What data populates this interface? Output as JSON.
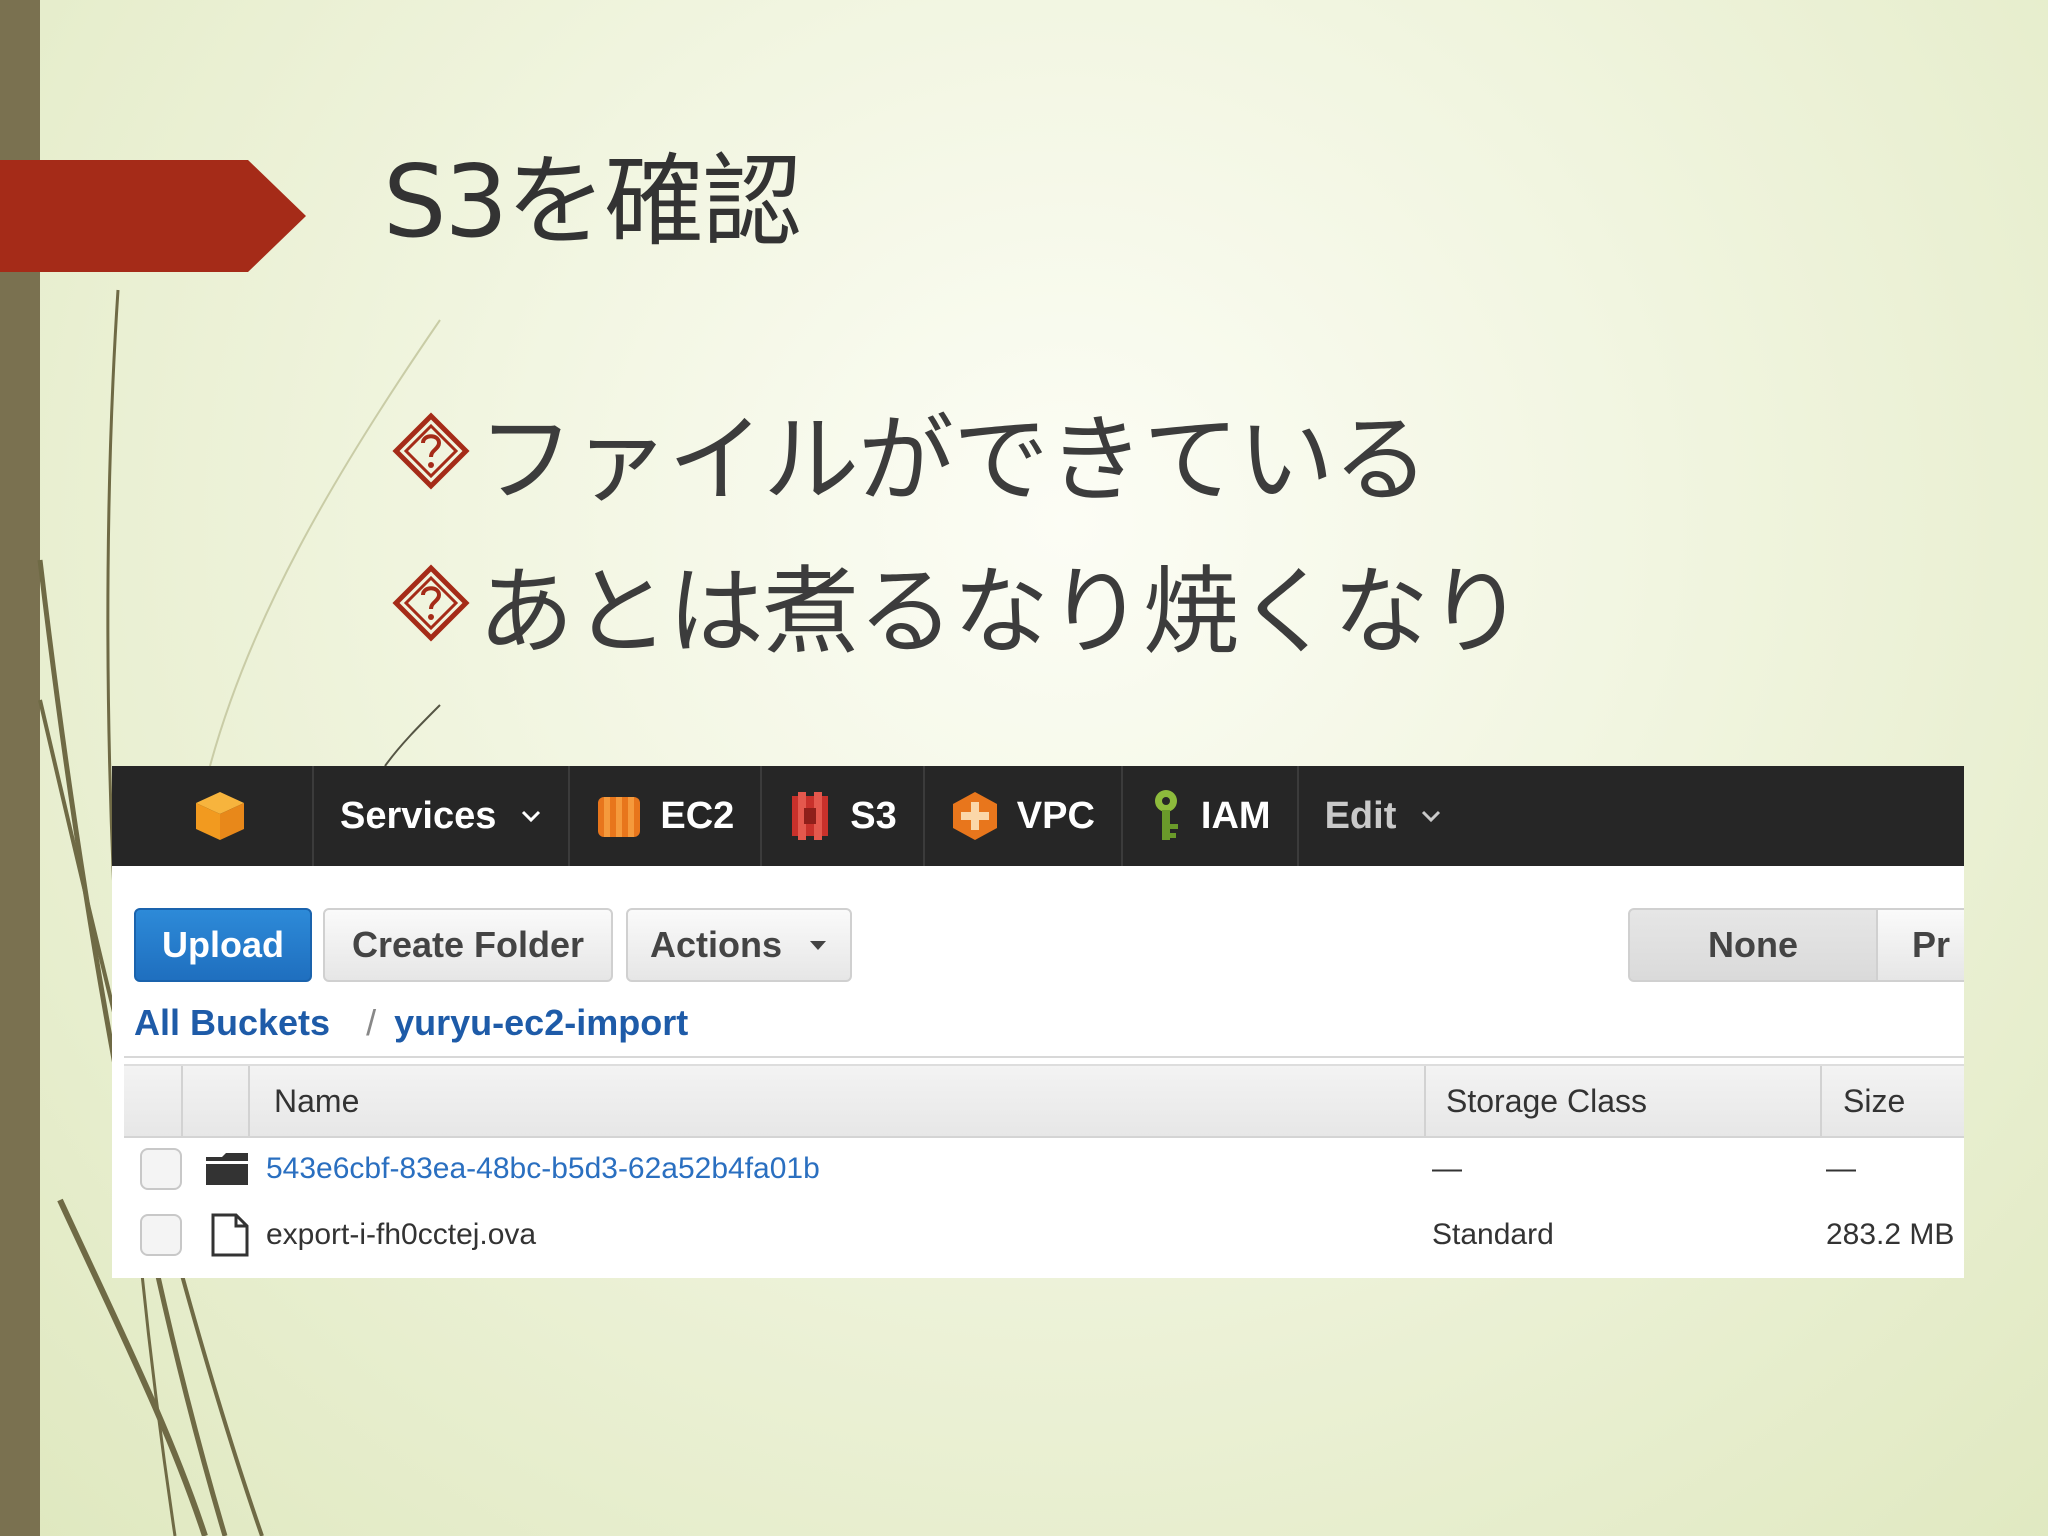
{
  "slide": {
    "title": "S3を確認",
    "bullets": [
      "ファイルができている",
      "あとは煮るなり焼くなり"
    ]
  },
  "colors": {
    "accent_arrow": "#a52b18",
    "left_band": "#7a7150",
    "aws_bar": "#262626",
    "upload_blue": "#1f6fbf",
    "link_blue": "#1e5ba8"
  },
  "console": {
    "topbar": {
      "logo_icon": "aws-cube-icon",
      "services_label": "Services",
      "items": [
        {
          "label": "EC2",
          "icon": "ec2-icon"
        },
        {
          "label": "S3",
          "icon": "s3-icon"
        },
        {
          "label": "VPC",
          "icon": "vpc-icon"
        },
        {
          "label": "IAM",
          "icon": "iam-key-icon"
        }
      ],
      "edit_label": "Edit"
    },
    "toolbar": {
      "upload_label": "Upload",
      "create_folder_label": "Create Folder",
      "actions_label": "Actions",
      "none_label": "None",
      "properties_label_visible": "Pr"
    },
    "breadcrumb": {
      "root": "All Buckets",
      "separator": "/",
      "bucket": "yuryu-ec2-import"
    },
    "table": {
      "headers": {
        "name": "Name",
        "storage_class": "Storage Class",
        "size": "Size"
      },
      "rows": [
        {
          "type_icon": "folder-icon",
          "name": "543e6cbf-83ea-48bc-b5d3-62a52b4fa01b",
          "storage_class": "—",
          "size": "—"
        },
        {
          "type_icon": "file-icon",
          "name": "export-i-fh0cctej.ova",
          "storage_class": "Standard",
          "size": "283.2 MB"
        }
      ]
    }
  }
}
